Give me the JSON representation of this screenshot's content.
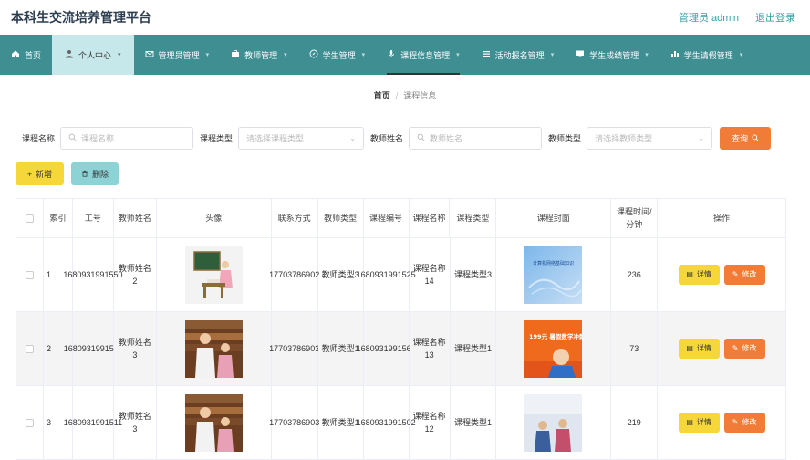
{
  "header": {
    "title": "本科生交流培养管理平台",
    "admin_label": "管理员 admin",
    "logout_label": "退出登录"
  },
  "nav": [
    {
      "label": "首页",
      "icon": "home-icon",
      "caret": false
    },
    {
      "label": "个人中心",
      "icon": "user-icon",
      "caret": true
    },
    {
      "label": "管理员管理",
      "icon": "mail-icon",
      "caret": true
    },
    {
      "label": "教师管理",
      "icon": "briefcase-icon",
      "caret": true
    },
    {
      "label": "学生管理",
      "icon": "compass-icon",
      "caret": true
    },
    {
      "label": "课程信息管理",
      "icon": "mic-icon",
      "caret": true
    },
    {
      "label": "活动报名管理",
      "icon": "list-icon",
      "caret": true
    },
    {
      "label": "学生成绩管理",
      "icon": "monitor-icon",
      "caret": true
    },
    {
      "label": "学生请假管理",
      "icon": "bar-chart-icon",
      "caret": true
    }
  ],
  "breadcrumb": {
    "home": "首页",
    "current": "课程信息"
  },
  "search": {
    "course_name_label": "课程名称",
    "course_name_placeholder": "课程名称",
    "course_type_label": "课程类型",
    "course_type_placeholder": "请选择课程类型",
    "teacher_name_label": "教师姓名",
    "teacher_name_placeholder": "教师姓名",
    "teacher_type_label": "教师类型",
    "teacher_type_placeholder": "请选择教师类型",
    "query_label": "查询"
  },
  "actions": {
    "add_label": "新增",
    "delete_label": "删除"
  },
  "table": {
    "headers": [
      "索引",
      "工号",
      "教师姓名",
      "头像",
      "联系方式",
      "教师类型",
      "课程编号",
      "课程名称",
      "课程类型",
      "课程封面",
      "课程时间/分钟",
      "操作"
    ],
    "detail_label": "详情",
    "edit_label": "修改",
    "rows": [
      {
        "index": "1",
        "job_no": "1680931991550",
        "teacher_name": "教师姓名2",
        "contact": "17703786902",
        "teacher_type": "教师类型3",
        "course_no": "1680931991525",
        "course_name": "课程名称14",
        "course_type": "课程类型3",
        "duration": "236",
        "cover_text": "计算机网络基础知识"
      },
      {
        "index": "2",
        "job_no": "1680931991511",
        "teacher_name": "教师姓名3",
        "contact": "17703786903",
        "teacher_type": "教师类型1",
        "course_no": "1680931991569",
        "course_name": "课程名称13",
        "course_type": "课程类型1",
        "duration": "73",
        "cover_text": "199元 暑假数学冲刺班"
      },
      {
        "index": "3",
        "job_no": "1680931991511",
        "teacher_name": "教师姓名3",
        "contact": "17703786903",
        "teacher_type": "教师类型1",
        "course_no": "1680931991502",
        "course_name": "课程名称12",
        "course_type": "课程类型1",
        "duration": "219",
        "cover_text": ""
      }
    ]
  },
  "colors": {
    "nav_bg": "#3e8e92",
    "nav_active_bg": "#c6e8ea",
    "accent_orange": "#f07c38",
    "accent_yellow": "#f5d73a",
    "accent_teal": "#8dd3d6"
  }
}
